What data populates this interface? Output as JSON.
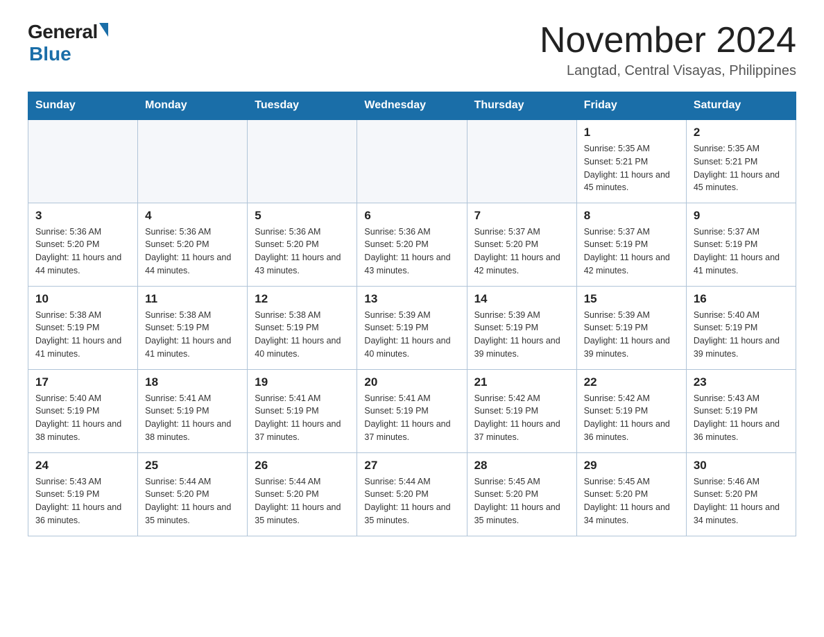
{
  "logo": {
    "general": "General",
    "blue": "Blue"
  },
  "title": "November 2024",
  "subtitle": "Langtad, Central Visayas, Philippines",
  "days_of_week": [
    "Sunday",
    "Monday",
    "Tuesday",
    "Wednesday",
    "Thursday",
    "Friday",
    "Saturday"
  ],
  "weeks": [
    [
      {
        "day": "",
        "info": ""
      },
      {
        "day": "",
        "info": ""
      },
      {
        "day": "",
        "info": ""
      },
      {
        "day": "",
        "info": ""
      },
      {
        "day": "",
        "info": ""
      },
      {
        "day": "1",
        "info": "Sunrise: 5:35 AM\nSunset: 5:21 PM\nDaylight: 11 hours and 45 minutes."
      },
      {
        "day": "2",
        "info": "Sunrise: 5:35 AM\nSunset: 5:21 PM\nDaylight: 11 hours and 45 minutes."
      }
    ],
    [
      {
        "day": "3",
        "info": "Sunrise: 5:36 AM\nSunset: 5:20 PM\nDaylight: 11 hours and 44 minutes."
      },
      {
        "day": "4",
        "info": "Sunrise: 5:36 AM\nSunset: 5:20 PM\nDaylight: 11 hours and 44 minutes."
      },
      {
        "day": "5",
        "info": "Sunrise: 5:36 AM\nSunset: 5:20 PM\nDaylight: 11 hours and 43 minutes."
      },
      {
        "day": "6",
        "info": "Sunrise: 5:36 AM\nSunset: 5:20 PM\nDaylight: 11 hours and 43 minutes."
      },
      {
        "day": "7",
        "info": "Sunrise: 5:37 AM\nSunset: 5:20 PM\nDaylight: 11 hours and 42 minutes."
      },
      {
        "day": "8",
        "info": "Sunrise: 5:37 AM\nSunset: 5:19 PM\nDaylight: 11 hours and 42 minutes."
      },
      {
        "day": "9",
        "info": "Sunrise: 5:37 AM\nSunset: 5:19 PM\nDaylight: 11 hours and 41 minutes."
      }
    ],
    [
      {
        "day": "10",
        "info": "Sunrise: 5:38 AM\nSunset: 5:19 PM\nDaylight: 11 hours and 41 minutes."
      },
      {
        "day": "11",
        "info": "Sunrise: 5:38 AM\nSunset: 5:19 PM\nDaylight: 11 hours and 41 minutes."
      },
      {
        "day": "12",
        "info": "Sunrise: 5:38 AM\nSunset: 5:19 PM\nDaylight: 11 hours and 40 minutes."
      },
      {
        "day": "13",
        "info": "Sunrise: 5:39 AM\nSunset: 5:19 PM\nDaylight: 11 hours and 40 minutes."
      },
      {
        "day": "14",
        "info": "Sunrise: 5:39 AM\nSunset: 5:19 PM\nDaylight: 11 hours and 39 minutes."
      },
      {
        "day": "15",
        "info": "Sunrise: 5:39 AM\nSunset: 5:19 PM\nDaylight: 11 hours and 39 minutes."
      },
      {
        "day": "16",
        "info": "Sunrise: 5:40 AM\nSunset: 5:19 PM\nDaylight: 11 hours and 39 minutes."
      }
    ],
    [
      {
        "day": "17",
        "info": "Sunrise: 5:40 AM\nSunset: 5:19 PM\nDaylight: 11 hours and 38 minutes."
      },
      {
        "day": "18",
        "info": "Sunrise: 5:41 AM\nSunset: 5:19 PM\nDaylight: 11 hours and 38 minutes."
      },
      {
        "day": "19",
        "info": "Sunrise: 5:41 AM\nSunset: 5:19 PM\nDaylight: 11 hours and 37 minutes."
      },
      {
        "day": "20",
        "info": "Sunrise: 5:41 AM\nSunset: 5:19 PM\nDaylight: 11 hours and 37 minutes."
      },
      {
        "day": "21",
        "info": "Sunrise: 5:42 AM\nSunset: 5:19 PM\nDaylight: 11 hours and 37 minutes."
      },
      {
        "day": "22",
        "info": "Sunrise: 5:42 AM\nSunset: 5:19 PM\nDaylight: 11 hours and 36 minutes."
      },
      {
        "day": "23",
        "info": "Sunrise: 5:43 AM\nSunset: 5:19 PM\nDaylight: 11 hours and 36 minutes."
      }
    ],
    [
      {
        "day": "24",
        "info": "Sunrise: 5:43 AM\nSunset: 5:19 PM\nDaylight: 11 hours and 36 minutes."
      },
      {
        "day": "25",
        "info": "Sunrise: 5:44 AM\nSunset: 5:20 PM\nDaylight: 11 hours and 35 minutes."
      },
      {
        "day": "26",
        "info": "Sunrise: 5:44 AM\nSunset: 5:20 PM\nDaylight: 11 hours and 35 minutes."
      },
      {
        "day": "27",
        "info": "Sunrise: 5:44 AM\nSunset: 5:20 PM\nDaylight: 11 hours and 35 minutes."
      },
      {
        "day": "28",
        "info": "Sunrise: 5:45 AM\nSunset: 5:20 PM\nDaylight: 11 hours and 35 minutes."
      },
      {
        "day": "29",
        "info": "Sunrise: 5:45 AM\nSunset: 5:20 PM\nDaylight: 11 hours and 34 minutes."
      },
      {
        "day": "30",
        "info": "Sunrise: 5:46 AM\nSunset: 5:20 PM\nDaylight: 11 hours and 34 minutes."
      }
    ]
  ]
}
